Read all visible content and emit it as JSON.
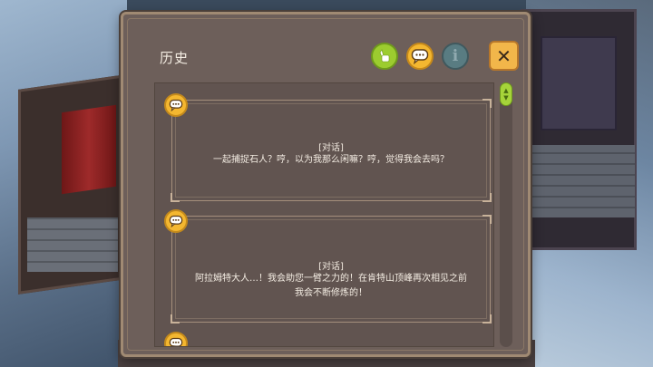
{
  "panel": {
    "title": "历史",
    "info_label": "i",
    "close_label": "✕"
  },
  "icons": {
    "hand": "hand-icon",
    "chat": "speech-bubble-icon",
    "info": "info-icon",
    "close": "close-icon"
  },
  "colors": {
    "accent_green": "#9ccc2f",
    "accent_yellow": "#f4b730",
    "panel_bg": "#6d5f5a"
  },
  "history": [
    {
      "tag": "[对话]",
      "text": "一起捕捉石人？哼，以为我那么闲嘛？哼，觉得我会去吗？"
    },
    {
      "tag": "[对话]",
      "text": "阿拉姆特大人…！我会助您一臂之力的！在肯特山顶峰再次相见之前我会不断修炼的！"
    }
  ],
  "scrollbar": {
    "up": "▲",
    "down": "▼"
  }
}
